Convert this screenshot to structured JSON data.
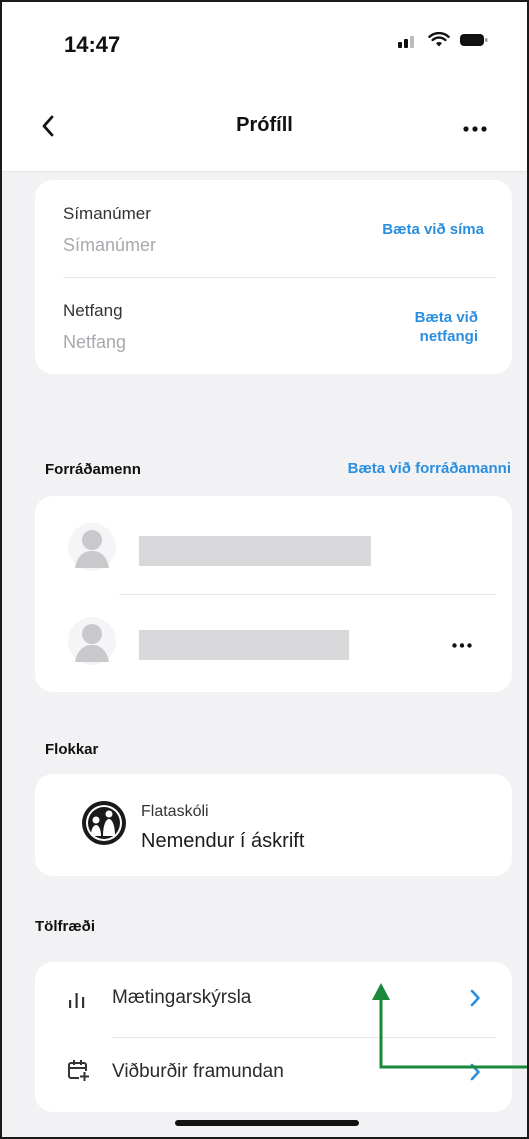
{
  "status_bar": {
    "time": "14:47"
  },
  "nav": {
    "title": "Prófíll"
  },
  "contact": {
    "phone": {
      "label": "Símanúmer",
      "placeholder": "Símanúmer",
      "action": "Bæta við síma"
    },
    "email": {
      "label": "Netfang",
      "placeholder": "Netfang",
      "action_line1": "Bæta við",
      "action_line2": "netfangi"
    }
  },
  "guardians": {
    "title": "Forráðamenn",
    "action": "Bæta við forráðamanni"
  },
  "groups": {
    "title": "Flokkar",
    "items": [
      {
        "school": "Flataskóli",
        "name": "Nemendur í áskrift"
      }
    ]
  },
  "stats": {
    "title": "Tölfræði",
    "items": [
      {
        "label": "Mætingarskýrsla",
        "icon": "bar-chart-icon"
      },
      {
        "label": "Viðburðir framundan",
        "icon": "calendar-plus-icon"
      }
    ]
  },
  "colors": {
    "accent": "#2b8fe0",
    "annotation": "#1a8a3a",
    "background": "#f2f2f4"
  }
}
